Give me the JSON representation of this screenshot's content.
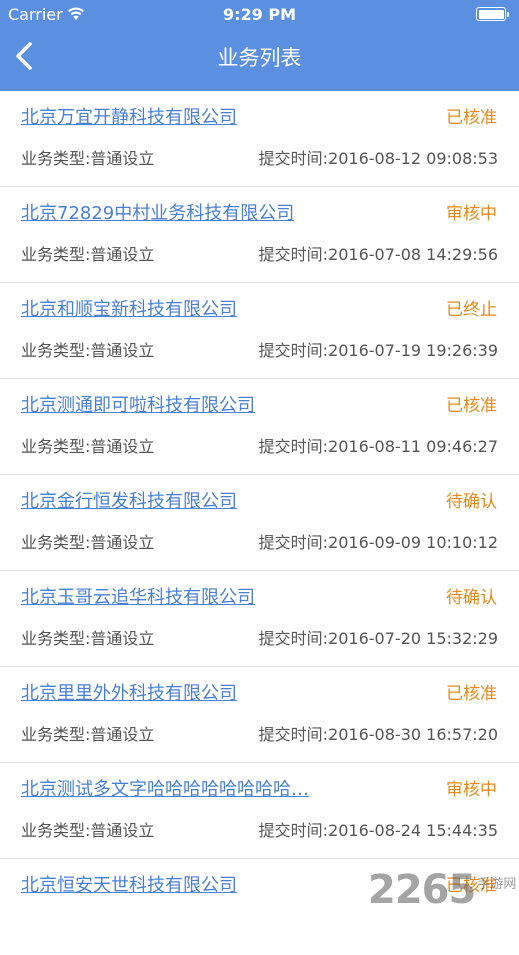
{
  "status_bar": {
    "carrier": "Carrier",
    "time": "9:29 PM"
  },
  "nav": {
    "title": "业务列表",
    "back_icon": "chevron-left-icon"
  },
  "colors": {
    "header_bg": "#5b8fe0",
    "link": "#4a80d4",
    "status": "#e8891a",
    "meta_text": "#555555"
  },
  "items": [
    {
      "company": "北京万宜开静科技有限公司",
      "status": "已核准",
      "biz_type": "业务类型:普通设立",
      "submit_time": "提交时间:2016-08-12 09:08:53"
    },
    {
      "company": "北京72829中村业务科技有限公司",
      "status": "审核中",
      "biz_type": "业务类型:普通设立",
      "submit_time": "提交时间:2016-07-08 14:29:56"
    },
    {
      "company": "北京和顺宝新科技有限公司",
      "status": "已终止",
      "biz_type": "业务类型:普通设立",
      "submit_time": "提交时间:2016-07-19 19:26:39"
    },
    {
      "company": "北京测通即可啦科技有限公司",
      "status": "已核准",
      "biz_type": "业务类型:普通设立",
      "submit_time": "提交时间:2016-08-11 09:46:27"
    },
    {
      "company": "北京金行恒发科技有限公司",
      "status": "待确认",
      "biz_type": "业务类型:普通设立",
      "submit_time": "提交时间:2016-09-09 10:10:12"
    },
    {
      "company": "北京玉哥云追华科技有限公司",
      "status": "待确认",
      "biz_type": "业务类型:普通设立",
      "submit_time": "提交时间:2016-07-20 15:32:29"
    },
    {
      "company": "北京里里外外科技有限公司",
      "status": "已核准",
      "biz_type": "业务类型:普通设立",
      "submit_time": "提交时间:2016-08-30 16:57:20"
    },
    {
      "company": "北京测试多文字哈哈哈哈哈哈哈哈…",
      "status": "审核中",
      "biz_type": "业务类型:普通设立",
      "submit_time": "提交时间:2016-08-24 15:44:35"
    },
    {
      "company": "北京恒安天世科技有限公司",
      "status": "已核准",
      "biz_type": "",
      "submit_time": ""
    }
  ],
  "watermark": {
    "mark": "2265",
    "sub": "手游网"
  }
}
